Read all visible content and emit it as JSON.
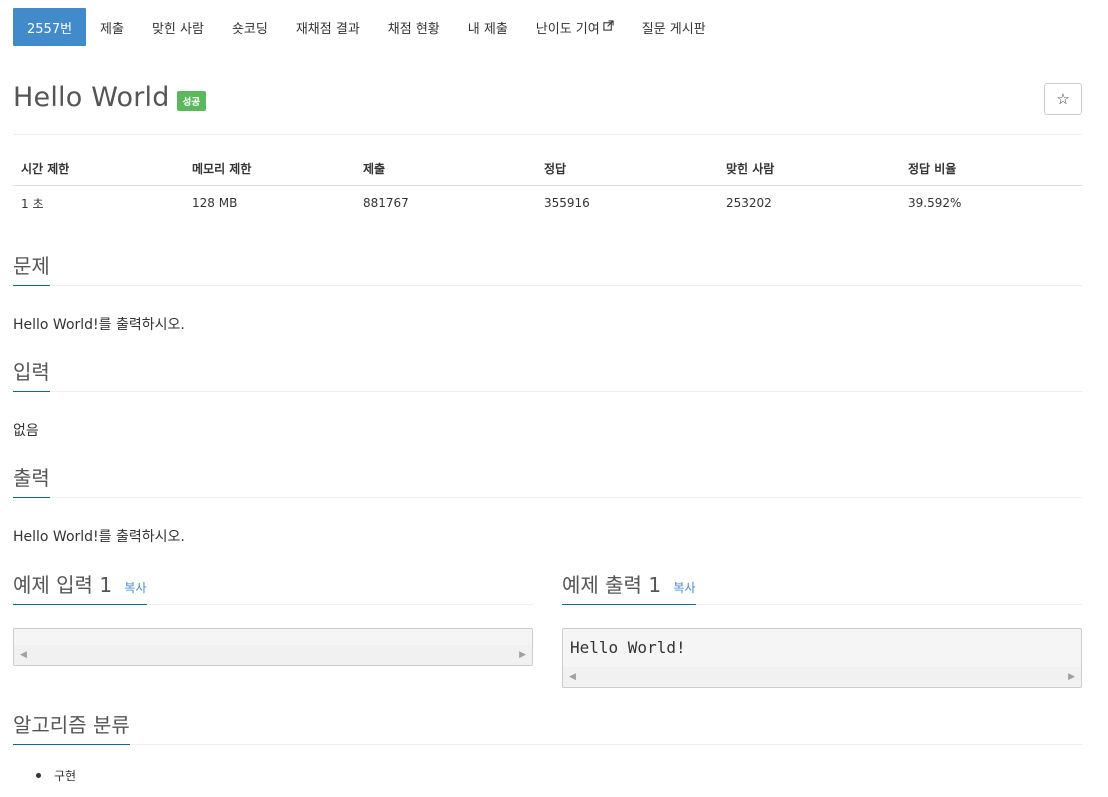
{
  "nav": {
    "items": [
      {
        "label": "2557번",
        "active": true
      },
      {
        "label": "제출"
      },
      {
        "label": "맞힌 사람"
      },
      {
        "label": "숏코딩"
      },
      {
        "label": "재채점 결과"
      },
      {
        "label": "채점 현황"
      },
      {
        "label": "내 제출"
      },
      {
        "label": "난이도 기여",
        "external": true
      },
      {
        "label": "질문 게시판"
      }
    ]
  },
  "problem": {
    "title": "Hello World",
    "status_badge": "성공",
    "star_icon": "☆"
  },
  "info": {
    "headers": [
      "시간 제한",
      "메모리 제한",
      "제출",
      "정답",
      "맞힌 사람",
      "정답 비율"
    ],
    "values": [
      "1 초",
      "128 MB",
      "881767",
      "355916",
      "253202",
      "39.592%"
    ]
  },
  "sections": {
    "problem": {
      "title": "문제",
      "text": "Hello World!를 출력하시오."
    },
    "input": {
      "title": "입력",
      "text": "없음"
    },
    "output": {
      "title": "출력",
      "text": "Hello World!를 출력하시오."
    }
  },
  "samples": {
    "input": {
      "title": "예제 입력 1",
      "copy": "복사",
      "content": ""
    },
    "output": {
      "title": "예제 출력 1",
      "copy": "복사",
      "content": "Hello World!"
    }
  },
  "algorithm": {
    "title": "알고리즘 분류",
    "items": [
      "구현"
    ]
  },
  "colors": {
    "active_tab": "#428bca",
    "success_badge": "#5cb85c",
    "section_underline": "#0e6b8f"
  }
}
